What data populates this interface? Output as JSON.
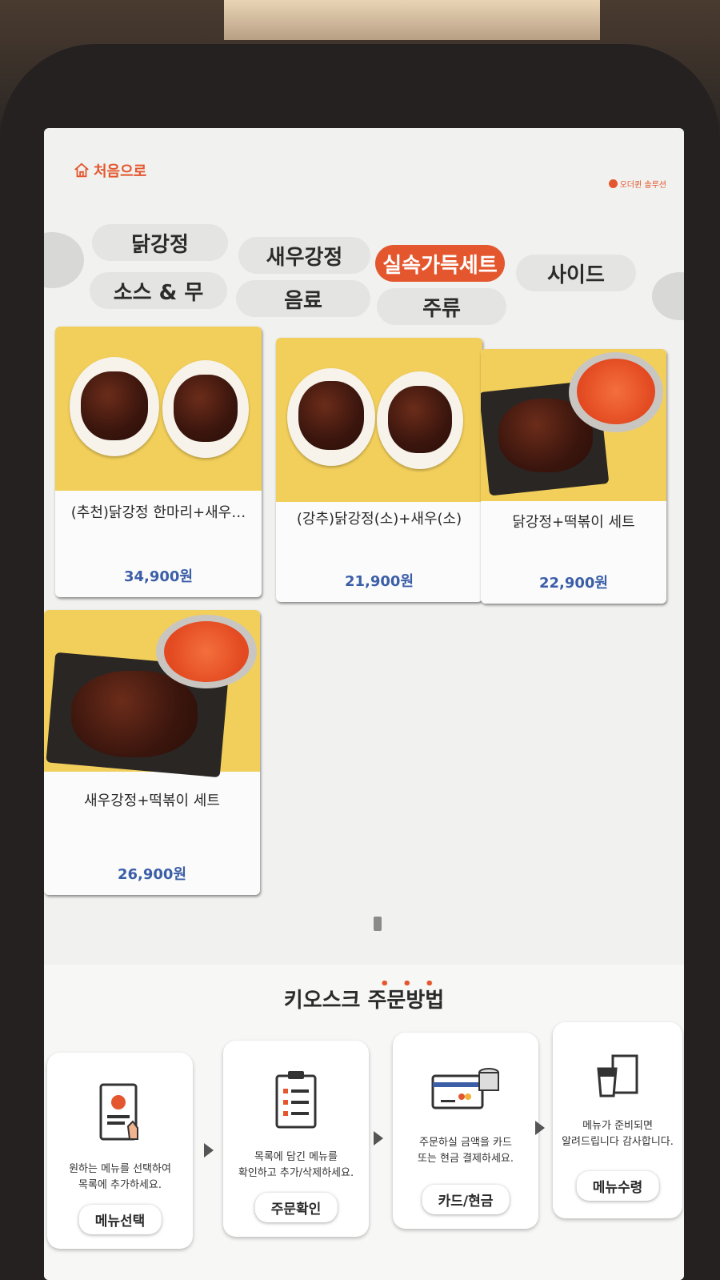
{
  "header": {
    "home_label": "처음으로",
    "brand": "오더퀸 솔루션"
  },
  "categories": [
    {
      "label": "닭강정",
      "active": false
    },
    {
      "label": "새우강정",
      "active": false
    },
    {
      "label": "실속가득세트",
      "active": true
    },
    {
      "label": "사이드",
      "active": false
    },
    {
      "label": "소스 & 무",
      "active": false
    },
    {
      "label": "음료",
      "active": false
    },
    {
      "label": "주류",
      "active": false
    }
  ],
  "menu": [
    {
      "name": "(추천)닭강정 한마리+새우…",
      "price": "34,900원"
    },
    {
      "name": "(강추)닭강정(소)+새우(소)",
      "price": "21,900원"
    },
    {
      "name": "닭강정+떡볶이 세트",
      "price": "22,900원"
    },
    {
      "name": "새우강정+떡볶이 세트",
      "price": "26,900원"
    }
  ],
  "guide": {
    "title_plain": "키오스크 ",
    "title_accent": "주문방법",
    "steps": [
      {
        "icon": "menu-tablet-icon",
        "desc_line1": "원하는 메뉴를 선택하여",
        "desc_line2": "목록에 추가하세요.",
        "button": "메뉴선택"
      },
      {
        "icon": "order-list-icon",
        "desc_line1": "목록에 담긴 메뉴를",
        "desc_line2": "확인하고 추가/삭제하세요.",
        "button": "주문확인"
      },
      {
        "icon": "card-cash-icon",
        "desc_line1": "주문하실 금액을 카드",
        "desc_line2": "또는 현금 결제하세요.",
        "button": "카드/현금"
      },
      {
        "icon": "takeout-bag-icon",
        "desc_line1": "메뉴가 준비되면",
        "desc_line2": "알려드립니다 감사합니다.",
        "button": "메뉴수령"
      }
    ]
  },
  "colors": {
    "accent": "#e4572e",
    "price": "#3b5ea7",
    "photo_bg": "#f2cf5a"
  }
}
